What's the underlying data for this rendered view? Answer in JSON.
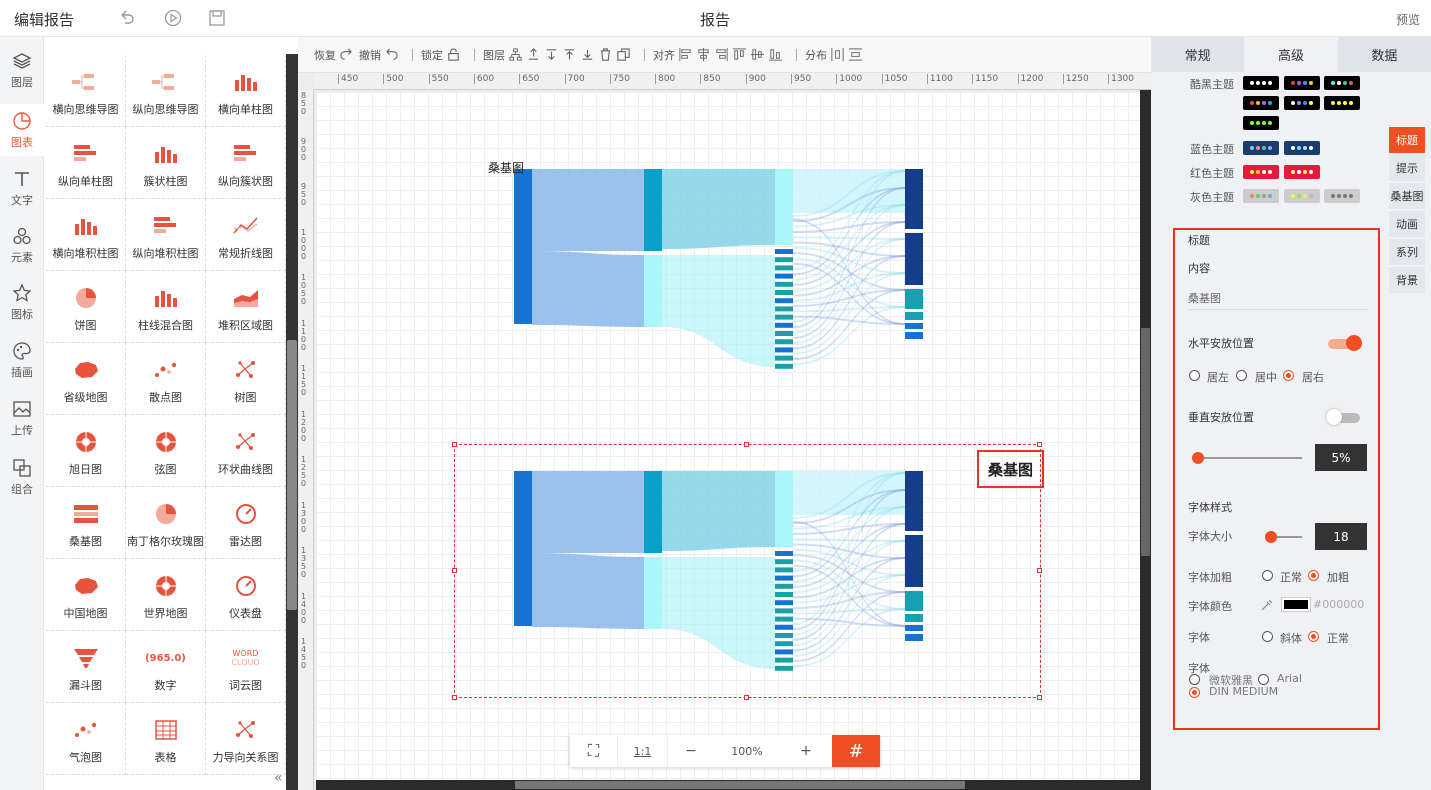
{
  "header": {
    "app_title": "编辑报告",
    "report_title": "报告",
    "preview": "预览"
  },
  "leftnav": [
    {
      "label": "图层",
      "icon": "layers-icon"
    },
    {
      "label": "图表",
      "icon": "chart-icon",
      "active": true
    },
    {
      "label": "文字",
      "icon": "text-icon"
    },
    {
      "label": "元素",
      "icon": "elements-icon"
    },
    {
      "label": "图标",
      "icon": "star-icon"
    },
    {
      "label": "插画",
      "icon": "palette-icon"
    },
    {
      "label": "上传",
      "icon": "upload-image-icon"
    },
    {
      "label": "组合",
      "icon": "group-icon"
    }
  ],
  "components": [
    "横向思维导图",
    "纵向思维导图",
    "横向单柱图",
    "纵向单柱图",
    "簇状柱图",
    "纵向簇状图",
    "横向堆积柱图",
    "纵向堆积柱图",
    "常规折线图",
    "饼图",
    "柱线混合图",
    "堆积区域图",
    "省级地图",
    "散点图",
    "树图",
    "旭日图",
    "弦图",
    "环状曲线图",
    "桑基图",
    "南丁格尔玫瑰图",
    "雷达图",
    "中国地图",
    "世界地图",
    "仪表盘",
    "漏斗图",
    "数字",
    "词云图",
    "气泡图",
    "表格",
    "力导向关系图"
  ],
  "component_icon_text": {
    "number": "(965.0)",
    "wordcloud_top": "WORD",
    "wordcloud_bottom": "CLOUD"
  },
  "toolbar": {
    "redo": "恢复",
    "undo": "撤销",
    "lock": "锁定",
    "layer": "图层",
    "align": "对齐",
    "distribute": "分布"
  },
  "ruler_ticks": [
    "450",
    "500",
    "550",
    "600",
    "650",
    "700",
    "750",
    "800",
    "850",
    "900",
    "950",
    "1000",
    "1050",
    "1100",
    "1150",
    "1200",
    "1250",
    "1300"
  ],
  "ruler_left": [
    "850",
    "900",
    "950",
    "1000",
    "1050",
    "1100",
    "1150",
    "1200",
    "1250",
    "1300",
    "1350",
    "1400",
    "1450"
  ],
  "canvas": {
    "chart1_title": "桑基图",
    "chart2_title": "桑基图"
  },
  "zoom": {
    "fit": "⛶",
    "one": "1:1",
    "minus": "−",
    "level": "100%",
    "plus": "+",
    "grid": "#"
  },
  "right": {
    "tabs": [
      "常规",
      "高级",
      "数据"
    ],
    "active_tab": "高级",
    "themes": [
      {
        "label": "酷黑主题"
      },
      {
        "label": "蓝色主题"
      },
      {
        "label": "红色主题"
      },
      {
        "label": "灰色主题"
      }
    ],
    "side_tabs": [
      "标题",
      "提示",
      "桑基图",
      "动画",
      "系列",
      "背景"
    ],
    "props": {
      "section_title": "标题",
      "content_label": "内容",
      "content_value": "桑基图",
      "h_pos_label": "水平安放位置",
      "h_left": "居左",
      "h_center": "居中",
      "h_right": "居右",
      "v_pos_label": "垂直安放位置",
      "v_value": "5%",
      "font_style_label": "字体样式",
      "font_size_label": "字体大小",
      "font_size_value": "18",
      "bold_label": "字体加粗",
      "bold_normal": "正常",
      "bold_bold": "加粗",
      "color_label": "字体颜色",
      "color_value": "#000000",
      "italic_label": "字体",
      "italic_italic": "斜体",
      "italic_normal": "正常",
      "family_label": "字体",
      "family_yahei": "微软雅黑",
      "family_arial": "Arial",
      "family_din": "DIN MEDIUM"
    }
  },
  "colors": {
    "accent": "#f04e23",
    "highlight_border": "#e8331f"
  }
}
